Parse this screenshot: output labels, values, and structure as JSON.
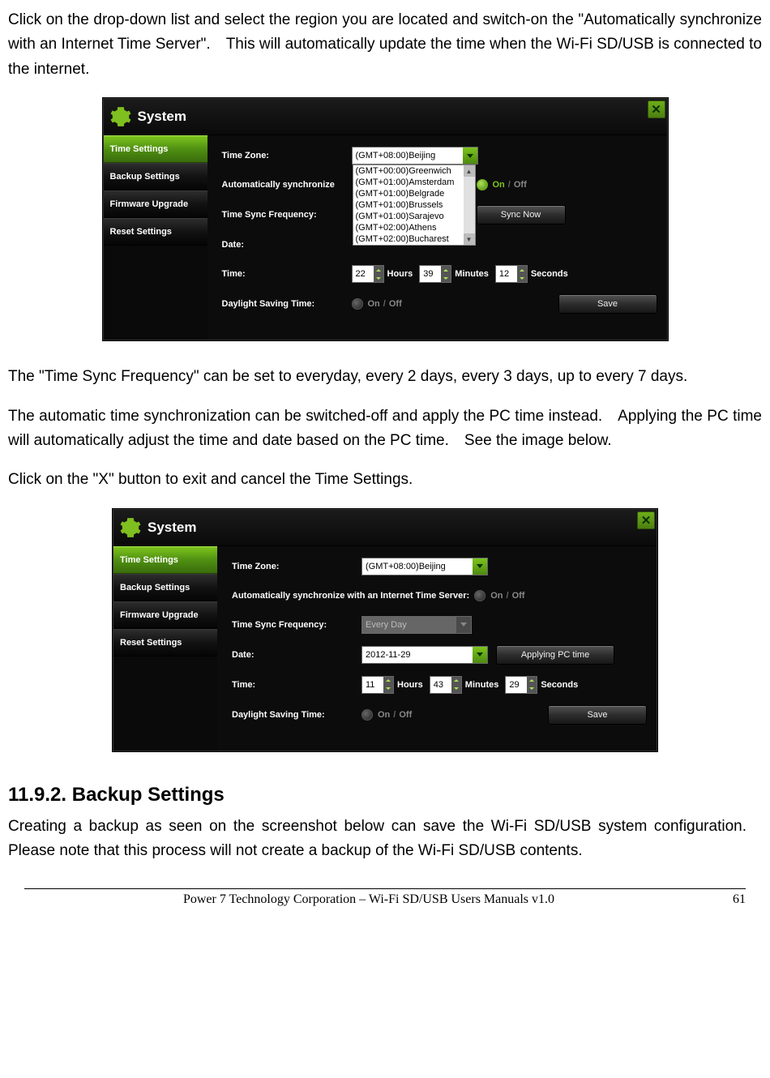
{
  "doc": {
    "para1": "Click on the drop-down list and select the region you are located and switch-on the \"Automatically synchronize with an Internet Time Server\". This will automatically update the time when the Wi-Fi SD/USB is connected to the internet.",
    "para2": "The \"Time Sync Frequency\" can be set to everyday, every 2 days, every 3 days, up to every 7 days.",
    "para3": "The automatic time synchronization can be switched-off and apply the PC time instead. Applying the PC time will automatically adjust the time and date based on the PC time. See the image below.",
    "para4": "Click on the \"X\" button to exit and cancel the Time Settings.",
    "heading": "11.9.2. Backup Settings",
    "para5": "Creating a backup as seen on the screenshot below can save the Wi-Fi SD/USB system configuration. Please note that this process will not create a backup of the Wi-Fi SD/USB contents.",
    "footer": "Power 7 Technology Corporation – Wi-Fi SD/USB Users Manuals v1.0",
    "page": "61"
  },
  "panel1": {
    "title": "System",
    "sidebar": [
      "Time Settings",
      "Backup Settings",
      "Firmware Upgrade",
      "Reset Settings"
    ],
    "labels": {
      "timezone": "Time Zone:",
      "autosync": "Automatically synchronize",
      "freq": "Time Sync Frequency:",
      "date": "Date:",
      "time": "Time:",
      "dst": "Daylight Saving Time:"
    },
    "timezone_value": "(GMT+08:00)Beijing",
    "dropdown_options": [
      "(GMT+00:00)Greenwich",
      "(GMT+01:00)Amsterdam",
      "(GMT+01:00)Belgrade",
      "(GMT+01:00)Brussels",
      "(GMT+01:00)Sarajevo",
      "(GMT+02:00)Athens",
      "(GMT+02:00)Bucharest"
    ],
    "toggle": {
      "on": "On",
      "off": "Off"
    },
    "sync_now": "Sync Now",
    "time_vals": {
      "h": "22",
      "m": "39",
      "s": "12"
    },
    "time_lbls": {
      "h": "Hours",
      "m": "Minutes",
      "s": "Seconds"
    },
    "save": "Save"
  },
  "panel2": {
    "title": "System",
    "sidebar": [
      "Time Settings",
      "Backup Settings",
      "Firmware Upgrade",
      "Reset Settings"
    ],
    "labels": {
      "timezone": "Time Zone:",
      "autosync": "Automatically synchronize with an Internet Time Server:",
      "freq": "Time Sync Frequency:",
      "date": "Date:",
      "time": "Time:",
      "dst": "Daylight Saving Time:"
    },
    "timezone_value": "(GMT+08:00)Beijing",
    "freq_value": "Every Day",
    "date_value": "2012-11-29",
    "pc_time": "Applying PC time",
    "toggle": {
      "on": "On",
      "off": "Off"
    },
    "time_vals": {
      "h": "11",
      "m": "43",
      "s": "29"
    },
    "time_lbls": {
      "h": "Hours",
      "m": "Minutes",
      "s": "Seconds"
    },
    "save": "Save"
  }
}
